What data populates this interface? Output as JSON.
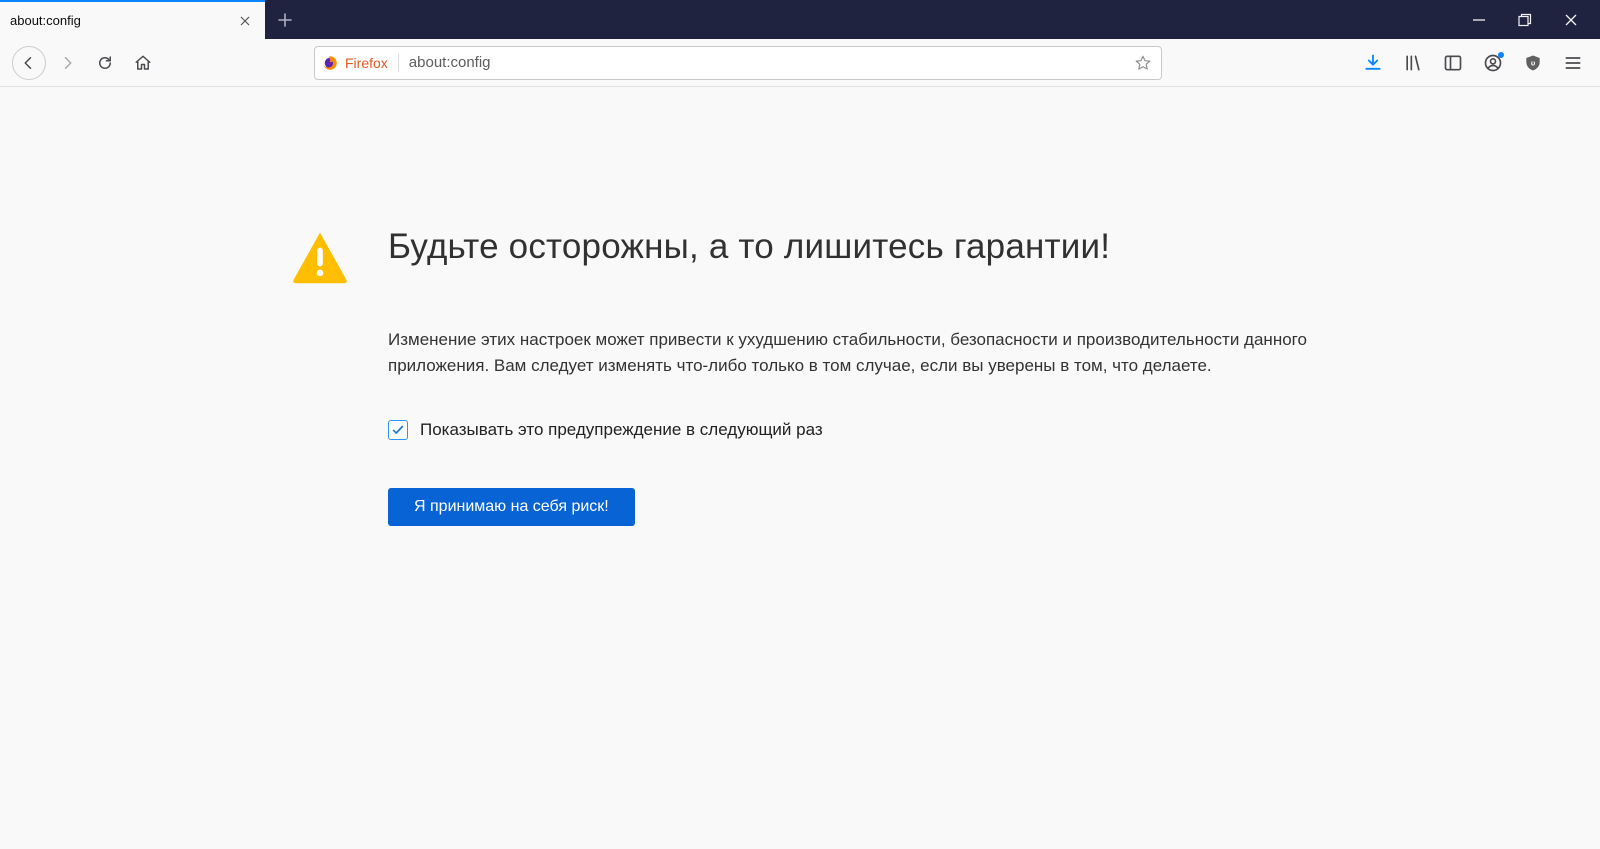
{
  "tab": {
    "title": "about:config"
  },
  "urlbar": {
    "identity_label": "Firefox",
    "url": "about:config"
  },
  "warning": {
    "title": "Будьте осторожны, а то лишитесь гарантии!",
    "description": "Изменение этих настроек может привести к ухудшению стабильности, безопасности и производительности данного приложения. Вам следует изменять что-либо только в том случае, если вы уверены в том, что делаете.",
    "checkbox_label": "Показывать это предупреждение в следующий раз",
    "checkbox_checked": true,
    "accept_button": "Я принимаю на себя риск!"
  }
}
